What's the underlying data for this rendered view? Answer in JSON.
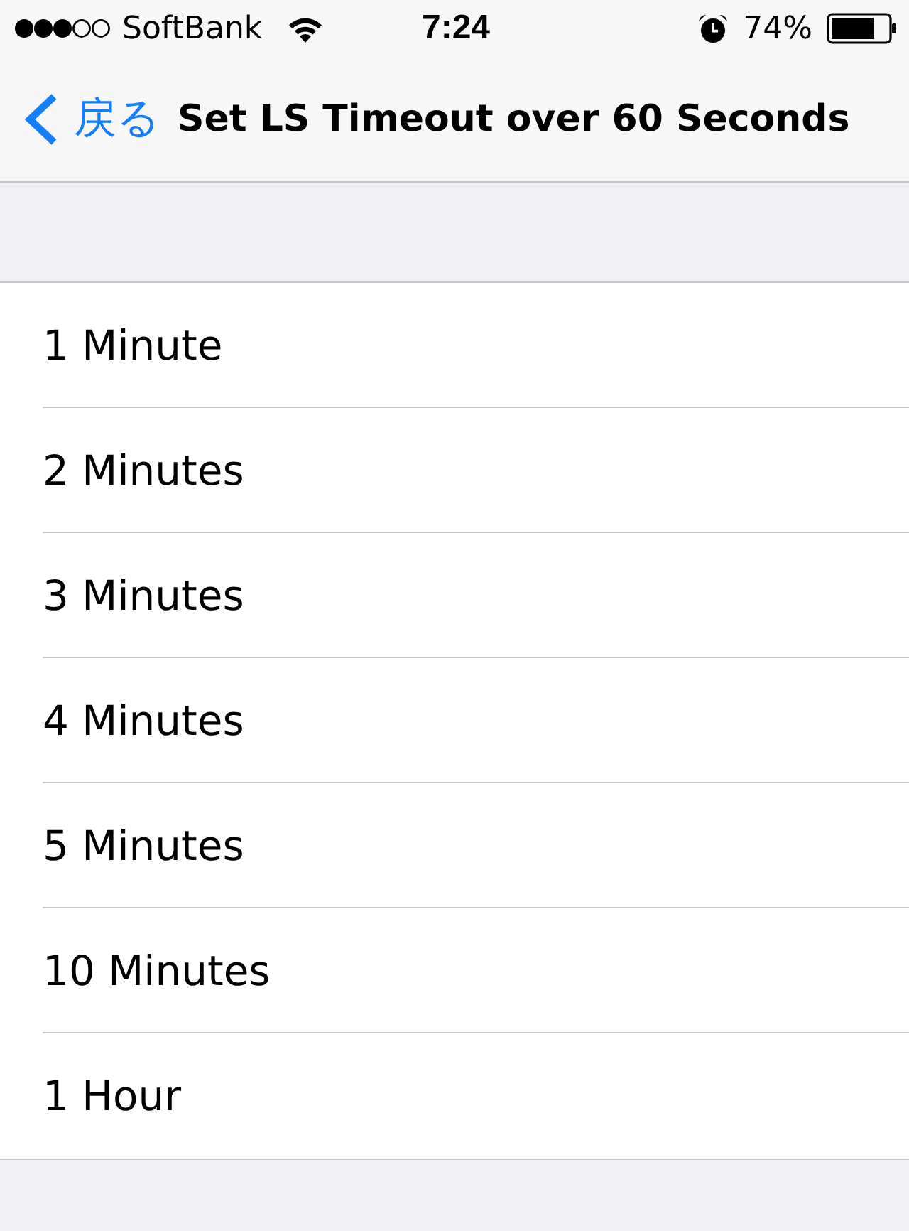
{
  "status_bar": {
    "carrier": "SoftBank",
    "time": "7:24",
    "battery": "74%"
  },
  "nav_bar": {
    "back": "戻る",
    "title": "Set LS Timeout over 60 Seconds"
  },
  "options": [
    {
      "label": "1 Minute"
    },
    {
      "label": "2 Minutes"
    },
    {
      "label": "3 Minutes"
    },
    {
      "label": "4 Minutes"
    },
    {
      "label": "5 Minutes"
    },
    {
      "label": "10 Minutes"
    },
    {
      "label": "1 Hour"
    }
  ]
}
